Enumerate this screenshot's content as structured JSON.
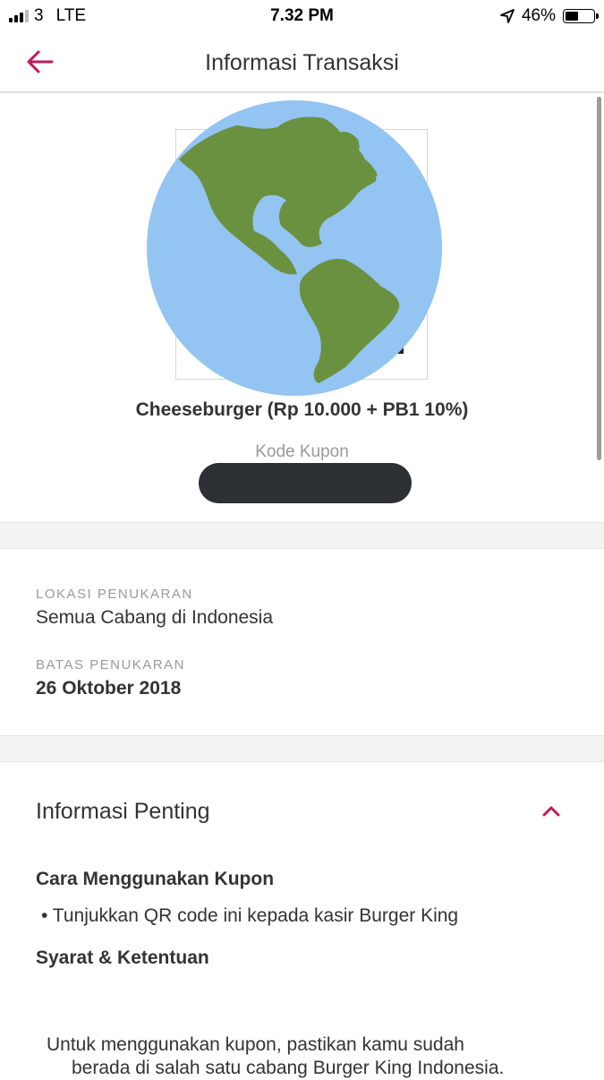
{
  "status_bar": {
    "carrier": "3",
    "network": "LTE",
    "time": "7.32 PM",
    "battery": "46%"
  },
  "header": {
    "title": "Informasi Transaksi"
  },
  "coupon": {
    "name": "Cheeseburger (Rp 10.000 + PB1 10%)",
    "code_label": "Kode Kupon"
  },
  "details": {
    "location_label": "LOKASI PENUKARAN",
    "location_value": "Semua Cabang di Indonesia",
    "deadline_label": "BATAS PENUKARAN",
    "deadline_value": "26 Oktober 2018"
  },
  "important_info": {
    "title": "Informasi Penting",
    "how_to_title": "Cara Menggunakan Kupon",
    "how_to_item": "• Tunjukkan QR code ini kepada kasir Burger King",
    "terms_title": "Syarat & Ketentuan",
    "terms_line1": "Untuk menggunakan kupon, pastikan kamu sudah",
    "terms_line2": "berada di salah satu cabang Burger King Indonesia."
  },
  "colors": {
    "accent": "#c2185b",
    "globe_ocean": "#93c4f2",
    "globe_land": "#6a9140",
    "redaction": "#2d3035"
  },
  "icons": {
    "back": "arrow-left-icon",
    "collapse": "chevron-up-icon",
    "location": "location-arrow-icon"
  }
}
